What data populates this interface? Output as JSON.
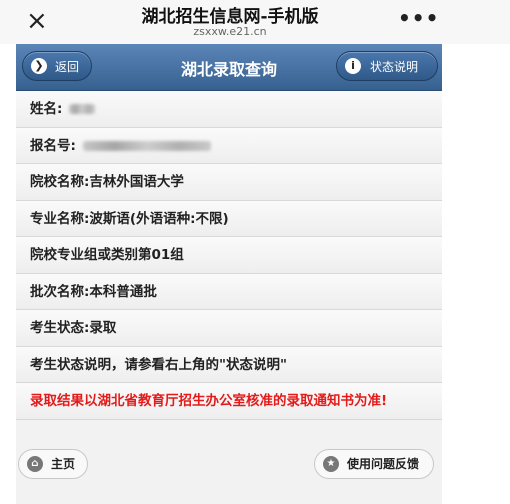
{
  "browser": {
    "title": "湖北招生信息网-手机版",
    "domain": "zsxxw.e21.cn",
    "close_icon": "×",
    "more_icon": "•••"
  },
  "navbar": {
    "back_label": "返回",
    "back_icon": "❯",
    "title": "湖北录取查询",
    "status_label": "状态说明",
    "status_icon": "i"
  },
  "rows": {
    "name_label": "姓名:",
    "regno_label": "报名号:",
    "school": "院校名称:吉林外国语大学",
    "major": "专业名称:波斯语(外语语种:不限)",
    "group": "院校专业组或类别第01组",
    "batch": "批次名称:本科普通批",
    "status": "考生状态:录取",
    "status_note": "考生状态说明，请参看右上角的\"状态说明\"",
    "warning": "录取结果以湖北省教育厅招生办公室核准的录取通知书为准!"
  },
  "footer": {
    "home_label": "主页",
    "home_icon": "⌂",
    "feedback_label": "使用问题反馈",
    "feedback_icon": "★"
  },
  "colors": {
    "navbar": "#4a77ad",
    "warning": "#e31b1b",
    "background": "#f2f2f2"
  }
}
